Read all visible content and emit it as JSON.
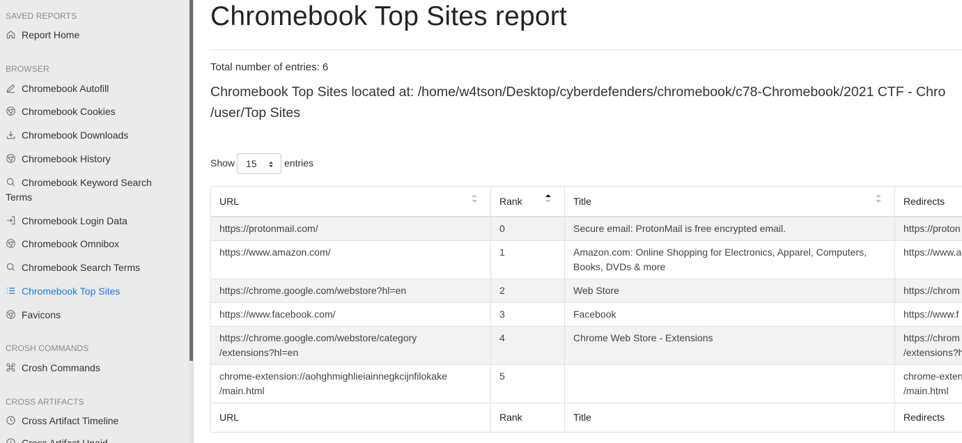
{
  "sidebar": {
    "sections": [
      {
        "heading": "SAVED REPORTS"
      },
      {
        "heading": "BROWSER"
      },
      {
        "heading": "CROSH COMMANDS"
      },
      {
        "heading": "CROSS ARTIFACTS"
      }
    ],
    "items": [
      {
        "label": "Report Home",
        "icon": "home-icon"
      },
      {
        "label": "Chromebook Autofill",
        "icon": "pencil-icon"
      },
      {
        "label": "Chromebook Cookies",
        "icon": "chrome-icon"
      },
      {
        "label": "Chromebook Downloads",
        "icon": "download-icon"
      },
      {
        "label": "Chromebook History",
        "icon": "chrome-icon"
      },
      {
        "label": "Chromebook Keyword Search",
        "label2": "Terms",
        "icon": "search-icon"
      },
      {
        "label": "Chromebook Login Data",
        "icon": "log-in-icon"
      },
      {
        "label": "Chromebook Omnibox",
        "icon": "chrome-icon"
      },
      {
        "label": "Chromebook Search Terms",
        "icon": "search-icon"
      },
      {
        "label": "Chromebook Top Sites",
        "icon": "list-icon",
        "active": true
      },
      {
        "label": "Favicons",
        "icon": "chrome-icon"
      },
      {
        "label": "Crosh Commands",
        "icon": "command-icon"
      },
      {
        "label": "Cross Artifact Timeline",
        "icon": "clock-icon"
      },
      {
        "label": "Cross Artifact Unaid...",
        "icon": "clock-icon"
      }
    ],
    "accent": "#1f7bd8"
  },
  "main": {
    "title": "Chromebook Top Sites report",
    "total": "Total number of entries: 6",
    "location_line1": "Chromebook Top Sites located at: /home/w4tson/Desktop/cyberdefenders/chromebook/c78-Chromebook/2021 CTF - Chro",
    "location_line2": "/user/Top Sites",
    "show_label": "Show",
    "entries_value": "15",
    "entries_label": "entries"
  },
  "table": {
    "headers": [
      "URL",
      "Rank",
      "Title",
      "Redirects"
    ],
    "rows": [
      {
        "url": "https://protonmail.com/",
        "url2": "",
        "rank": "0",
        "title": "Secure email: ProtonMail is free encrypted email.",
        "title2": "",
        "redirects": "https://proton",
        "redirects2": ""
      },
      {
        "url": "https://www.amazon.com/",
        "url2": "",
        "rank": "1",
        "title": "Amazon.com: Online Shopping for Electronics, Apparel, Computers,",
        "title2": "Books, DVDs & more",
        "redirects": "https://www.a",
        "redirects2": ""
      },
      {
        "url": "https://chrome.google.com/webstore?hl=en",
        "url2": "",
        "rank": "2",
        "title": "Web Store",
        "title2": "",
        "redirects": "https://chrom",
        "redirects2": ""
      },
      {
        "url": "https://www.facebook.com/",
        "url2": "",
        "rank": "3",
        "title": "Facebook",
        "title2": "",
        "redirects": "https://www.f",
        "redirects2": ""
      },
      {
        "url": "https://chrome.google.com/webstore/category",
        "url2": "/extensions?hl=en",
        "rank": "4",
        "title": "Chrome Web Store - Extensions",
        "title2": "",
        "redirects": "https://chrom",
        "redirects2": "/extensions?h"
      },
      {
        "url": "chrome-extension://aohghmighlieiainnegkcijnfilokake",
        "url2": "/main.html",
        "rank": "5",
        "title": "",
        "title2": "",
        "redirects": "chrome-exten",
        "redirects2": "/main.html"
      }
    ],
    "footers": [
      "URL",
      "Rank",
      "Title",
      "Redirects"
    ]
  }
}
